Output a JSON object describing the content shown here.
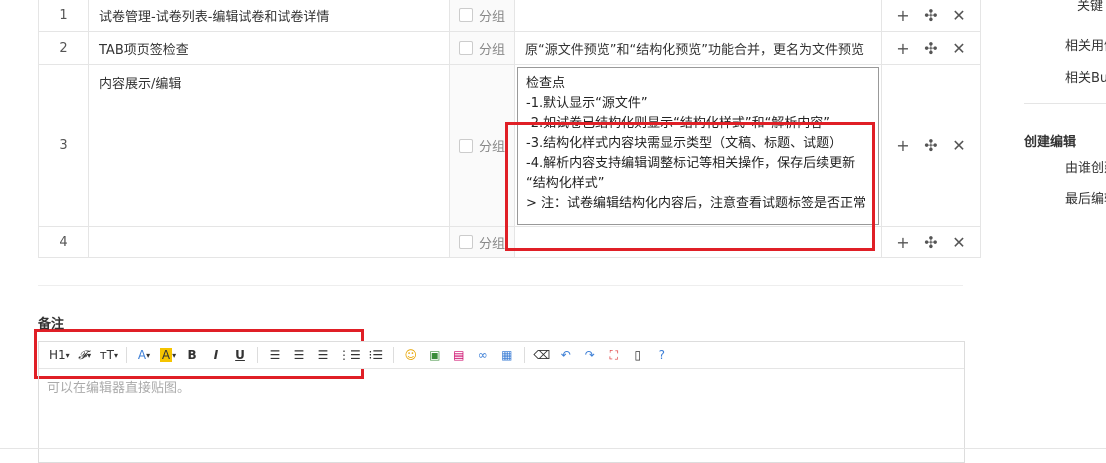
{
  "steps": [
    {
      "num": "1",
      "step": "试卷管理-试卷列表-编辑试卷和试卷详情",
      "group_label": "分组",
      "expected": ""
    },
    {
      "num": "2",
      "step": "TAB项页签检查",
      "group_label": "分组",
      "expected": "原“源文件预览”和“结构化预览”功能合并，更名为文件预览"
    },
    {
      "num": "3",
      "step": "内容展示/编辑",
      "group_label": "分组",
      "expected_lines": [
        "检查点",
        "-1.默认显示“源文件”",
        "-2.如试卷已结构化则显示“结构化样式”和“解析内容”",
        "-3.结构化样式内容块需显示类型（文稿、标题、试题）",
        "-4.解析内容支持编辑调整标记等相关操作，保存后续更新",
        "“结构化样式”",
        "> 注：试卷编辑结构化内容后，注意查看试题标签是否正常"
      ]
    },
    {
      "num": "4",
      "step": "",
      "group_label": "分组",
      "expected": ""
    }
  ],
  "actions": {
    "add": "+",
    "move": "✣",
    "delete": "✕"
  },
  "sidebar": {
    "keyword_label": "关键",
    "related_case": "相关用例",
    "related_bug": "相关Bu",
    "create_edit": "创建编辑",
    "created_by": "由谁创建",
    "last_edited": "最后编辑"
  },
  "remarks": {
    "title": "备注",
    "placeholder": "可以在编辑器直接贴图。"
  },
  "toolbar": {
    "heading": "H1",
    "font": "𝓕",
    "size": "тT",
    "bold": "B",
    "italic": "I",
    "underline": "U"
  },
  "colors": {
    "highlight": "#e01f26",
    "font_color_icon": "#3d7fd6",
    "bg_color_icon": "#f5c400"
  }
}
